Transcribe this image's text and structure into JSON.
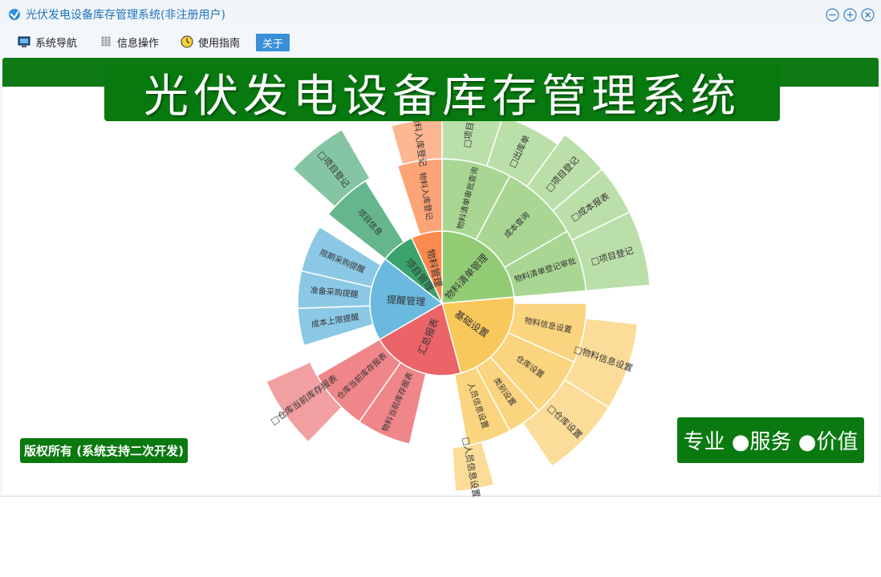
{
  "window": {
    "title": "光伏发电设备库存管理系统(非注册用户)"
  },
  "menu": {
    "items": [
      {
        "label": "系统导航",
        "icon": "monitor-icon"
      },
      {
        "label": "信息操作",
        "icon": "grid-icon"
      },
      {
        "label": "使用指南",
        "icon": "clock-icon"
      },
      {
        "label": "关于",
        "icon": ""
      }
    ]
  },
  "banner": {
    "title": "光伏发电设备库存管理系统"
  },
  "footer": {
    "copyright": "版权所有 (系统支持二次开发)",
    "slogan": "专业 ●服务 ●价值"
  },
  "sunburst": {
    "colors": {
      "物料管理": "#fb8a4f",
      "项目管理": "#3aa26b",
      "提醒管理": "#6ab9de",
      "汇总报表": "#ea6468",
      "基础设置": "#f9c85a",
      "物料清单管理": "#91cc75"
    },
    "ring1": [
      {
        "label": "物料清单管理",
        "group": "物料清单管理"
      },
      {
        "label": "基础设置",
        "group": "基础设置"
      },
      {
        "label": "汇总报表",
        "group": "汇总报表"
      },
      {
        "label": "提醒管理",
        "group": "提醒管理"
      },
      {
        "label": "项目管理",
        "group": "项目管理"
      },
      {
        "label": "物料管理",
        "group": "物料管理"
      }
    ],
    "ring2": [
      {
        "label": "物料清单登记审批",
        "group": "物料清单管理"
      },
      {
        "label": "成本查询",
        "group": "物料清单管理"
      },
      {
        "label": "物料清单审批查询",
        "group": "物料清单管理"
      },
      {
        "label": "物料信息设置",
        "group": "基础设置"
      },
      {
        "label": "仓库设置",
        "group": "基础设置"
      },
      {
        "label": "类别设置",
        "group": "基础设置"
      },
      {
        "label": "人员信息设置",
        "group": "基础设置"
      },
      {
        "label": "物料当前库存报表",
        "group": "汇总报表"
      },
      {
        "label": "仓库当前库存报表",
        "group": "汇总报表"
      },
      {
        "label": "成本上限提醒",
        "group": "提醒管理"
      },
      {
        "label": "准备采购提醒",
        "group": "提醒管理"
      },
      {
        "label": "限期采购提醒",
        "group": "提醒管理"
      },
      {
        "label": "项目信息",
        "group": "项目管理"
      },
      {
        "label": "物料入库登记",
        "group": "物料管理"
      }
    ],
    "ring3": [
      {
        "label": "□项目登记",
        "group": "物料清单管理"
      },
      {
        "label": "□成本报表",
        "group": "物料清单管理"
      },
      {
        "label": "□项目登记",
        "group": "物料清单管理"
      },
      {
        "label": "□出库单",
        "group": "物料清单管理"
      },
      {
        "label": "□项目",
        "group": "物料清单管理"
      },
      {
        "label": "□物料信息设置",
        "group": "基础设置"
      },
      {
        "label": "□仓库设置",
        "group": "基础设置"
      },
      {
        "label": "□人员信息设置",
        "group": "基础设置"
      },
      {
        "label": "□仓库当前库存报表",
        "group": "汇总报表"
      },
      {
        "label": "□项目登记",
        "group": "项目管理"
      },
      {
        "label": "物料入库登记",
        "group": "物料管理"
      }
    ]
  }
}
